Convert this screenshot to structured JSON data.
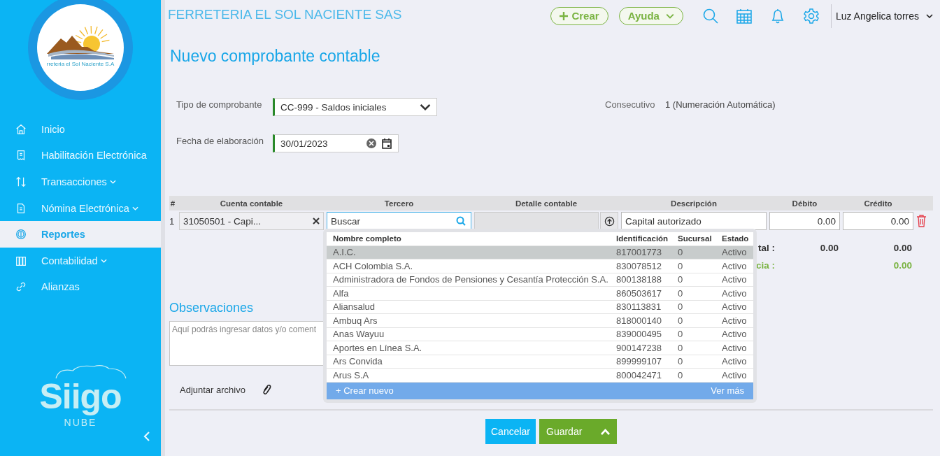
{
  "sidebar": {
    "logo_text": "rreteria el Sol Naciente S.A",
    "items": [
      {
        "label": "Inicio",
        "expandable": false,
        "selected": false
      },
      {
        "label": "Habilitación Electrónica",
        "expandable": false,
        "selected": false
      },
      {
        "label": "Transacciones",
        "expandable": true,
        "selected": false
      },
      {
        "label": "Nómina Electrónica",
        "expandable": true,
        "selected": false
      },
      {
        "label": "Reportes",
        "expandable": false,
        "selected": true
      },
      {
        "label": "Contabilidad",
        "expandable": true,
        "selected": false
      },
      {
        "label": "Alianzas",
        "expandable": false,
        "selected": false
      }
    ],
    "brand": "Siigo",
    "brand_sub": "NUBE"
  },
  "header": {
    "company": "FERRETERIA EL SOL NACIENTE SAS",
    "buttons": [
      {
        "label": "Crear",
        "kind": "create"
      },
      {
        "label": "Ayuda",
        "kind": "menu"
      }
    ],
    "user": "Luz Angelica torres"
  },
  "title": "Nuevo comprobante contable",
  "form": {
    "fields": [
      {
        "label": "Tipo de comprobante",
        "kind": "select",
        "value": "CC-999 - Saldos iniciales"
      },
      {
        "label": "Fecha de elaboración",
        "kind": "date",
        "value": "30/01/2023"
      }
    ],
    "consecutivo": {
      "label": "Consecutivo",
      "value": "1 (Numeración Automática)"
    }
  },
  "table": {
    "columns": [
      "#",
      "Cuenta contable",
      "Tercero",
      "Detalle contable",
      "Descripción",
      "Débito",
      "Crédito"
    ],
    "rows": [
      {
        "number": "1",
        "account": "31050501 - Capi...",
        "third_party_placeholder": "Buscar",
        "description": "Capital autorizado",
        "debit": "0.00",
        "credit": "0.00"
      }
    ]
  },
  "totals": [
    {
      "kind": "total",
      "label": "tal :",
      "debit": "0.00",
      "credit": "0.00"
    },
    {
      "kind": "difference",
      "label": "cia :",
      "credit": "0.00"
    }
  ],
  "dropdown": {
    "columns": [
      "Nombre completo",
      "Identificación",
      "Sucursal",
      "Estado"
    ],
    "rows": [
      {
        "name": "A.I.C.",
        "id": "817001773",
        "branch": "0",
        "status": "Activo",
        "selected": true
      },
      {
        "name": "ACH Colombia S.A.",
        "id": "830078512",
        "branch": "0",
        "status": "Activo",
        "selected": false
      },
      {
        "name": "Administradora de Fondos de Pensiones y Cesantía Protección S.A.",
        "id": "800138188",
        "branch": "0",
        "status": "Activo",
        "selected": false
      },
      {
        "name": "Alfa",
        "id": "860503617",
        "branch": "0",
        "status": "Activo",
        "selected": false
      },
      {
        "name": "Aliansalud",
        "id": "830113831",
        "branch": "0",
        "status": "Activo",
        "selected": false
      },
      {
        "name": "Ambuq Ars",
        "id": "818000140",
        "branch": "0",
        "status": "Activo",
        "selected": false
      },
      {
        "name": "Anas Wayuu",
        "id": "839000495",
        "branch": "0",
        "status": "Activo",
        "selected": false
      },
      {
        "name": "Aportes en Línea S.A.",
        "id": "900147238",
        "branch": "0",
        "status": "Activo",
        "selected": false
      },
      {
        "name": "Ars Convida",
        "id": "899999107",
        "branch": "0",
        "status": "Activo",
        "selected": false
      },
      {
        "name": "Arus S.A",
        "id": "800042471",
        "branch": "0",
        "status": "Activo",
        "selected": false
      }
    ],
    "create": "+ Crear nuevo",
    "more": "Ver más"
  },
  "observations": {
    "title": "Observaciones",
    "placeholder": "Aquí podrás ingresar datos y/o coment"
  },
  "attach": "Adjuntar archivo",
  "actions": [
    {
      "label": "Cancelar",
      "kind": "cancel"
    },
    {
      "label": "Guardar",
      "kind": "save"
    }
  ]
}
